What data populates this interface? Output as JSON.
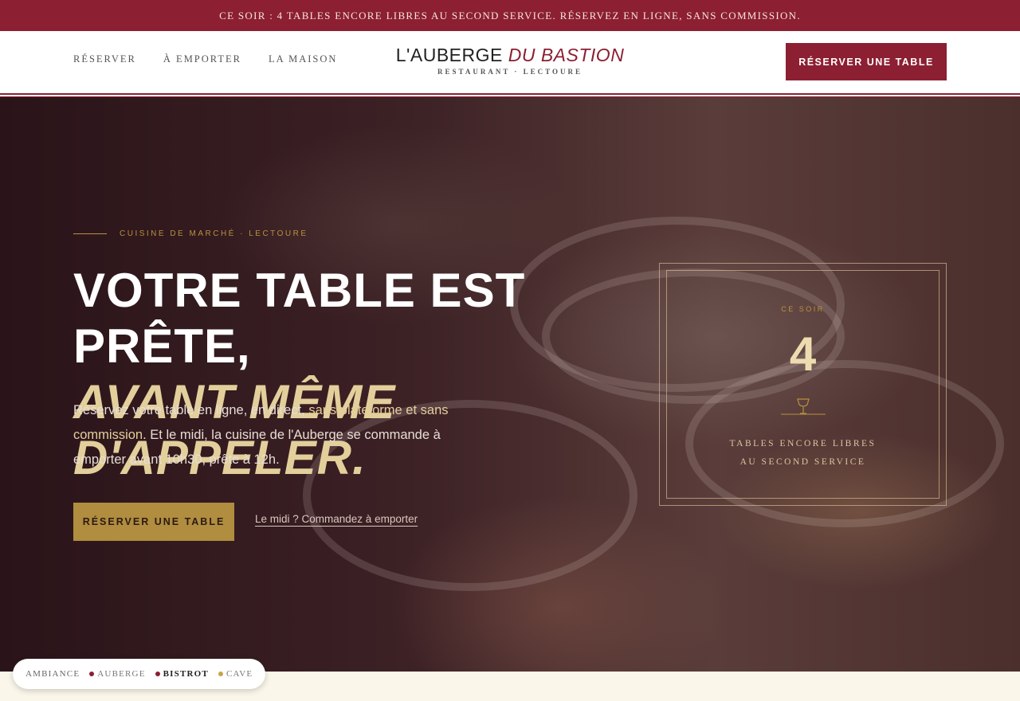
{
  "announcement": "CE SOIR : 4 TABLES ENCORE LIBRES AU SECOND SERVICE. RÉSERVEZ EN LIGNE, SANS COMMISSION.",
  "nav": {
    "items": [
      {
        "label": "RÉSERVER"
      },
      {
        "label": "À EMPORTER"
      },
      {
        "label": "LA MAISON"
      }
    ]
  },
  "logo": {
    "main": "L'AUBERGE",
    "accent": "DU BASTION",
    "sub": "RESTAURANT · LECTOURE"
  },
  "header_cta": "RÉSERVER UNE TABLE",
  "hero": {
    "eyebrow": "CUISINE DE MARCHÉ · LECTOURE",
    "headline_1": "VOTRE TABLE EST PRÊTE,",
    "headline_2": "AVANT MÊME D'APPELER.",
    "intro_1": "Réservez votre table en ligne, en direct, ",
    "intro_hl": "sans plateforme et sans commission",
    "intro_2": ". Et le midi, la cuisine de l'Auberge se commande à emporter avant 10h30, prête à 12h.",
    "cta": "RÉSERVER UNE TABLE",
    "link": "Le midi ? Commandez à emporter"
  },
  "status": {
    "label": "CE SOIR",
    "number": "4",
    "caption_1": "TABLES ENCORE LIBRES",
    "caption_2": "AU SECOND SERVICE"
  },
  "ambiance": {
    "label": "AMBIANCE",
    "options": [
      {
        "label": "AUBERGE",
        "color": "#8c1f32"
      },
      {
        "label": "BISTROT",
        "color": "#8c1f32"
      },
      {
        "label": "CAVE",
        "color": "#c9a24a"
      }
    ],
    "active": "BISTROT"
  },
  "colors": {
    "brand_red": "#8c1f32",
    "gold": "#b08d3f",
    "cream": "#e3cf9b"
  }
}
